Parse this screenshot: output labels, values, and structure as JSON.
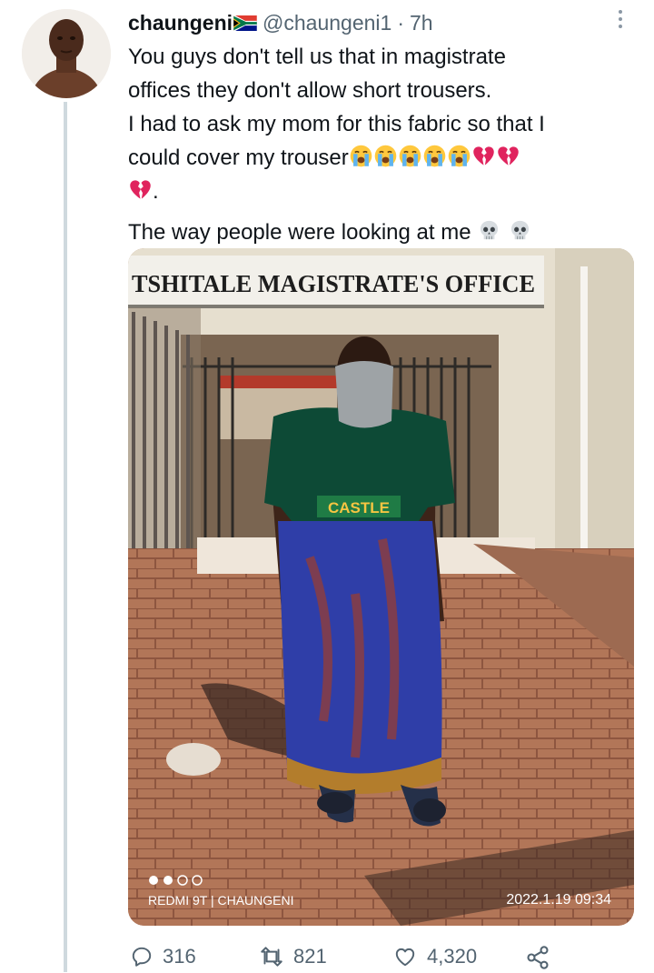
{
  "tweet": {
    "display_name": "chaungeni",
    "handle": "@chaungeni1",
    "separator": "·",
    "time": "7h",
    "text_lines": [
      "You guys don't tell us that in magistrate",
      "offices they don't allow short trousers.",
      "I had to ask my mom for this fabric so that I",
      "could cover my trouser"
    ],
    "text_period": ".",
    "text_last": "The way people were looking at me",
    "emojis": [
      "loudly-crying-face",
      "loudly-crying-face",
      "loudly-crying-face",
      "loudly-crying-face",
      "loudly-crying-face",
      "broken-heart",
      "broken-heart",
      "broken-heart",
      "skull",
      "skull"
    ]
  },
  "photo": {
    "sign_text": "TSHITALE MAGISTRATE'S OFFICE",
    "jersey_text": "CASTLE",
    "watermark_device": "REDMI 9T | CHAUNGENI",
    "watermark_datetime": "2022.1.19  09:34"
  },
  "actions": {
    "replies": "316",
    "retweets": "821",
    "likes": "4,320"
  },
  "colors": {
    "secondary_text": "#536471",
    "thread_line": "#cfd9de"
  }
}
